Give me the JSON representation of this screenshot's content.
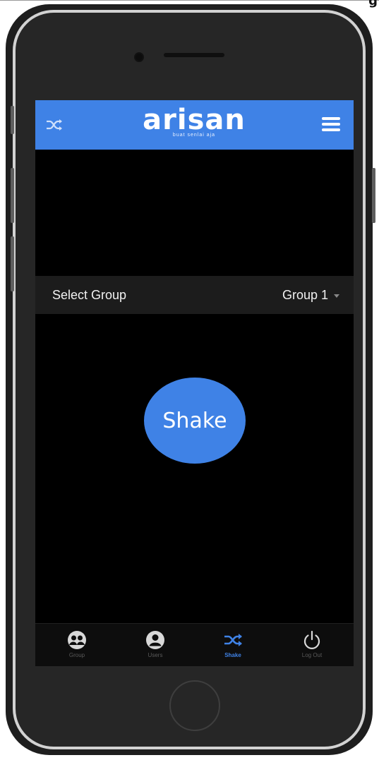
{
  "corner_glyph": "g",
  "app": {
    "logo": "arisan",
    "tagline": "buat senlai aja"
  },
  "header": {
    "left_icon": "shuffle-icon",
    "right_icon": "menu-icon"
  },
  "select_group": {
    "label": "Select Group",
    "value": "Group 1"
  },
  "shake_button": {
    "label": "Shake"
  },
  "tabs": [
    {
      "label": "Group",
      "icon": "group-icon",
      "active": false
    },
    {
      "label": "Users",
      "icon": "user-icon",
      "active": false
    },
    {
      "label": "Shake",
      "icon": "shuffle-icon",
      "active": true
    },
    {
      "label": "Log Out",
      "icon": "power-icon",
      "active": false
    }
  ],
  "colors": {
    "accent": "#3f82e6",
    "screen_bg": "#000000",
    "select_row_bg": "#1c1c1c",
    "tab_inactive": "#5a5a5a"
  }
}
